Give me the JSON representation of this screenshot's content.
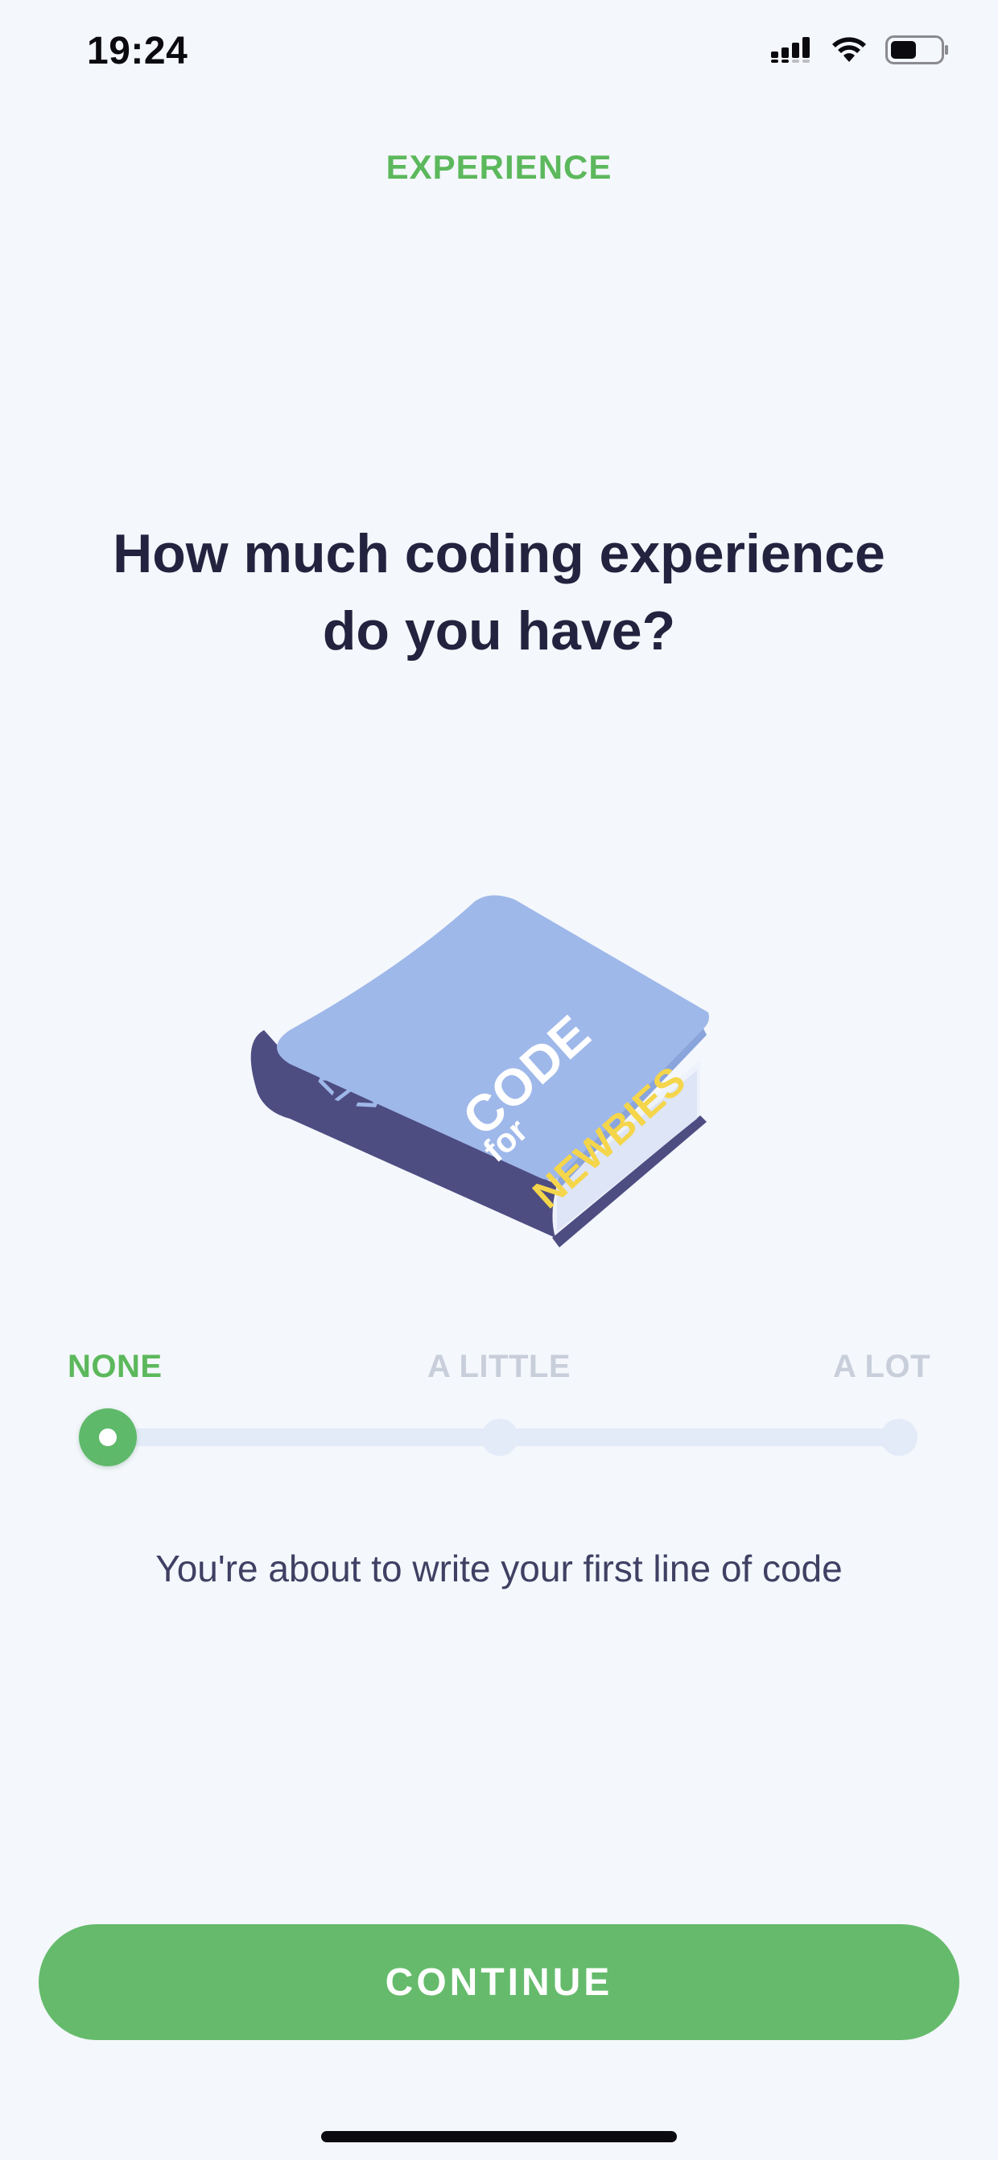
{
  "status_bar": {
    "time": "19:24",
    "icons": [
      "cellular-signal-icon",
      "wifi-icon",
      "battery-icon"
    ]
  },
  "header": {
    "title": "EXPERIENCE"
  },
  "question": {
    "line1": "How much coding experience",
    "line2": "do you have?"
  },
  "illustration": {
    "name": "book-illustration",
    "cover_text": [
      "CODE",
      "for",
      "NEWBIES"
    ],
    "spine_text": "</>"
  },
  "slider": {
    "options": [
      "NONE",
      "A LITTLE",
      "A LOT"
    ],
    "selected_index": 0,
    "selected_value": "NONE"
  },
  "description": "You're about to write your first line of code",
  "continue_button": {
    "label": "CONTINUE"
  },
  "colors": {
    "background": "#f4f7fc",
    "accent_green": "#5cb85c",
    "button_green": "#65bb6b",
    "heading": "#23233f",
    "track": "#e3ebf8",
    "inactive_label": "#c8ceda"
  }
}
